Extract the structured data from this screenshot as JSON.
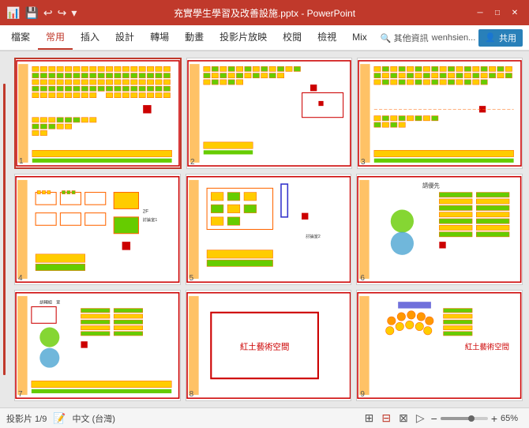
{
  "titlebar": {
    "title": "充實學生學習及改善設施.pptx - PowerPoint",
    "minimize": "─",
    "maximize": "□",
    "close": "✕"
  },
  "quickaccess": {
    "save": "💾",
    "undo": "↩",
    "redo": "↪",
    "dropdown": "▾"
  },
  "ribbon": {
    "tabs": [
      "檔案",
      "常用",
      "插入",
      "設計",
      "轉場",
      "動畫",
      "投影片放映",
      "校閱",
      "檢視",
      "Mix"
    ],
    "active": "常用",
    "search_placeholder": "其他資訊",
    "user": "wenhsien...",
    "share": "共用"
  },
  "slides": [
    {
      "id": 1,
      "label": "1",
      "type": "classroom_full"
    },
    {
      "id": 2,
      "label": "2",
      "type": "classroom_half"
    },
    {
      "id": 3,
      "label": "3",
      "type": "classroom_full2"
    },
    {
      "id": 4,
      "label": "4",
      "type": "library"
    },
    {
      "id": 5,
      "label": "5",
      "type": "office"
    },
    {
      "id": 6,
      "label": "6",
      "type": "trees"
    },
    {
      "id": 7,
      "label": "7",
      "type": "trees2"
    },
    {
      "id": 8,
      "label": "8",
      "type": "red_stage"
    },
    {
      "id": 9,
      "label": "9",
      "type": "red_stage2"
    }
  ],
  "statusbar": {
    "slide_info": "投影片 1/9",
    "language": "中文 (台灣)",
    "zoom": "65%",
    "zoom_minus": "−",
    "zoom_plus": "+"
  }
}
